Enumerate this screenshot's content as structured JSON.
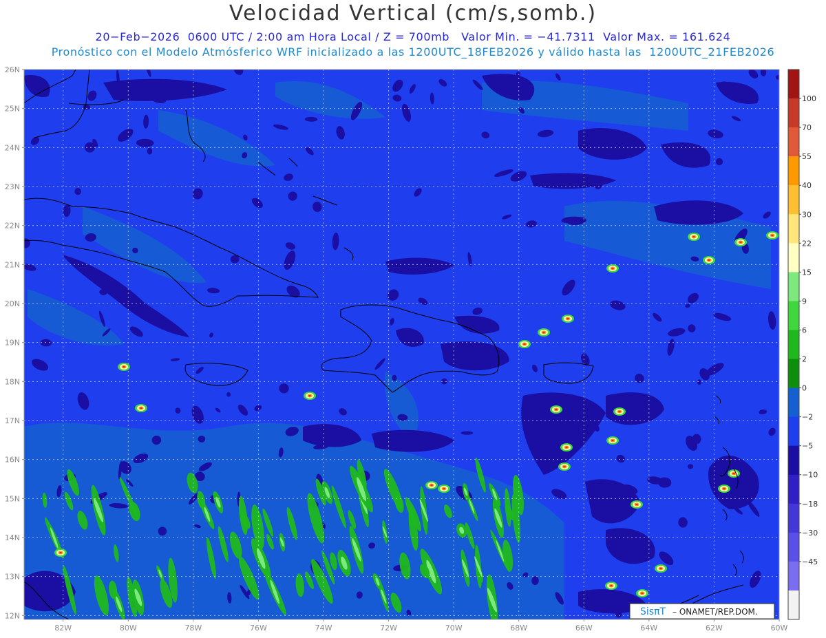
{
  "header": {
    "title": "Velocidad Vertical (cm/s,somb.)",
    "line1": "20−Feb−2026  0600 UTC / 2:00 am Hora Local / Z = 700mb   Valor Min. = −41.7311  Valor Max. = 161.624",
    "line2": "Pronóstico con el Modelo Atmósferico WRF inicializado a las 1200UTC_18FEB2026 y válido hasta las  1200UTC_21FEB2026"
  },
  "map": {
    "lat_labels": [
      "26N",
      "25N",
      "24N",
      "23N",
      "22N",
      "21N",
      "20N",
      "19N",
      "18N",
      "17N",
      "16N",
      "15N",
      "14N",
      "13N",
      "12N"
    ],
    "lon_labels": [
      "82W",
      "80W",
      "78W",
      "76W",
      "74W",
      "72W",
      "70W",
      "68W",
      "66W",
      "64W",
      "62W",
      "60W"
    ],
    "lon_range": [
      -83.2,
      -60
    ],
    "lat_range": [
      11.9,
      26
    ],
    "background_color": "#1f3fef",
    "attribution": {
      "brand": "SisπT",
      "text": "– ONAMET/REP.DOM."
    }
  },
  "colorbar": {
    "labels": [
      "100",
      "70",
      "55",
      "40",
      "30",
      "22",
      "15",
      "9",
      "6",
      "2",
      "0",
      "−2",
      "−5",
      "−10",
      "−18",
      "−30",
      "−45"
    ],
    "colors": [
      "#f2f2f2",
      "#7b6df0",
      "#5a4fe6",
      "#4437d8",
      "#2f1fc4",
      "#1a0ea3",
      "#1f3fef",
      "#1560d0",
      "#0d8f0d",
      "#1fb81f",
      "#3fd63f",
      "#7de87d",
      "#ffffc4",
      "#ffe57a",
      "#ffbf33",
      "#ff9900",
      "#e05a3a",
      "#c83a28",
      "#a01414"
    ]
  },
  "features": {
    "wind_level_note": ""
  }
}
